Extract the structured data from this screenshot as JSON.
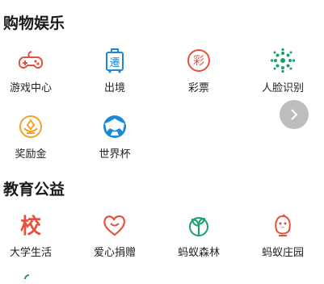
{
  "sections": [
    {
      "title": "购物娱乐",
      "items": [
        {
          "label": "游戏中心",
          "icon": "gamepad-icon"
        },
        {
          "label": "出境",
          "icon": "luggage-icon"
        },
        {
          "label": "彩票",
          "icon": "lottery-icon"
        },
        {
          "label": "人脸识别",
          "icon": "face-dots-icon"
        },
        {
          "label": "奖励金",
          "icon": "reward-coin-icon"
        },
        {
          "label": "世界杯",
          "icon": "soccer-ball-icon"
        }
      ]
    },
    {
      "title": "教育公益",
      "items": [
        {
          "label": "大学生活",
          "icon": "school-icon"
        },
        {
          "label": "爱心捐赠",
          "icon": "heart-donate-icon"
        },
        {
          "label": "蚂蚁森林",
          "icon": "sprout-icon"
        },
        {
          "label": "蚂蚁庄园",
          "icon": "chick-icon"
        }
      ]
    }
  ],
  "icon_texts": {
    "luggage": "遷",
    "lottery": "彩",
    "school": "校"
  },
  "colors": {
    "red": "#e5533f",
    "blue": "#1e88d8",
    "green": "#1aa06a",
    "orange": "#f1a22b",
    "gray": "#bdbdbd"
  },
  "pager": {
    "icon": "chevron-right-icon"
  }
}
